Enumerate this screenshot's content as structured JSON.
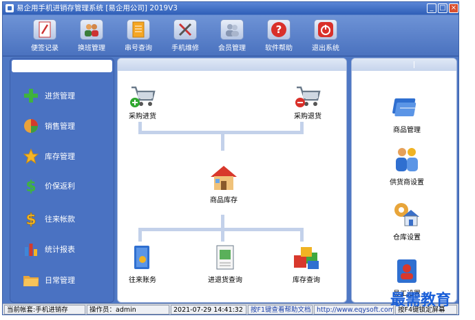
{
  "window": {
    "title": "易企用手机进销存管理系统 [易企用公司] 2019V3"
  },
  "toolbar": {
    "buttons": [
      {
        "label": "便签记录",
        "icon": "notebook-icon"
      },
      {
        "label": "换班管理",
        "icon": "shift-people-icon"
      },
      {
        "label": "串号查询",
        "icon": "serial-doc-icon"
      },
      {
        "label": "手机维修",
        "icon": "tools-icon"
      },
      {
        "label": "会员管理",
        "icon": "members-icon"
      },
      {
        "label": "软件帮助",
        "icon": "help-icon"
      },
      {
        "label": "退出系统",
        "icon": "power-icon"
      }
    ]
  },
  "sidebar": {
    "items": [
      {
        "label": "进货管理",
        "icon": "plus-icon"
      },
      {
        "label": "销售管理",
        "icon": "pie-icon"
      },
      {
        "label": "库存管理",
        "icon": "star-icon"
      },
      {
        "label": "价保返利",
        "icon": "dollar-icon"
      },
      {
        "label": "往来帐款",
        "icon": "dollar-gold-icon"
      },
      {
        "label": "统计报表",
        "icon": "bar-chart-icon"
      },
      {
        "label": "日常管理",
        "icon": "folder-icon"
      }
    ]
  },
  "main": {
    "purchase_in": "采购进货",
    "purchase_return": "采购退货",
    "inventory": "商品库存",
    "accounts": "往来账务",
    "io_query": "进退货查询",
    "stock_query": "库存查询"
  },
  "right": {
    "items": [
      "商品管理",
      "供货商设置",
      "仓库设置",
      "员工设置"
    ]
  },
  "status": {
    "account": "当前帐套:手机进销存",
    "operator": "操作员：admin",
    "datetime": "2021-07-29 14:41:32",
    "help": "按F1键查看帮助文档",
    "url": "http://www.eqysoft.com/",
    "lock": "按F4键锁定屏幕"
  },
  "watermark": "最需教育",
  "colors": {
    "accent": "#4a72c2",
    "title_bar": "#2f5fb8"
  }
}
